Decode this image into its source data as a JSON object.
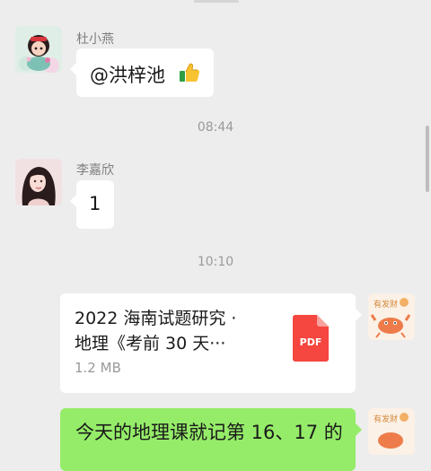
{
  "messages": [
    {
      "sender": "杜小燕",
      "text": "@洪梓池",
      "emoji_icon": "thumbs-up-emoji"
    },
    {
      "sender": "李嘉欣",
      "text": "1"
    },
    {
      "file": {
        "title_line1": "2022 海南试题研究 ·",
        "title_line2": "地理《考前 30 天···",
        "size": "1.2 MB",
        "type_label": "PDF",
        "icon": "pdf-file-icon"
      }
    },
    {
      "text_partial": "今天的地理课就记第 16、17 的"
    }
  ],
  "timestamps": [
    "08:44",
    "10:10"
  ],
  "colors": {
    "background": "#ededed",
    "bubble_in": "#ffffff",
    "bubble_out": "#95ec69",
    "pdf_red": "#f5463f"
  }
}
